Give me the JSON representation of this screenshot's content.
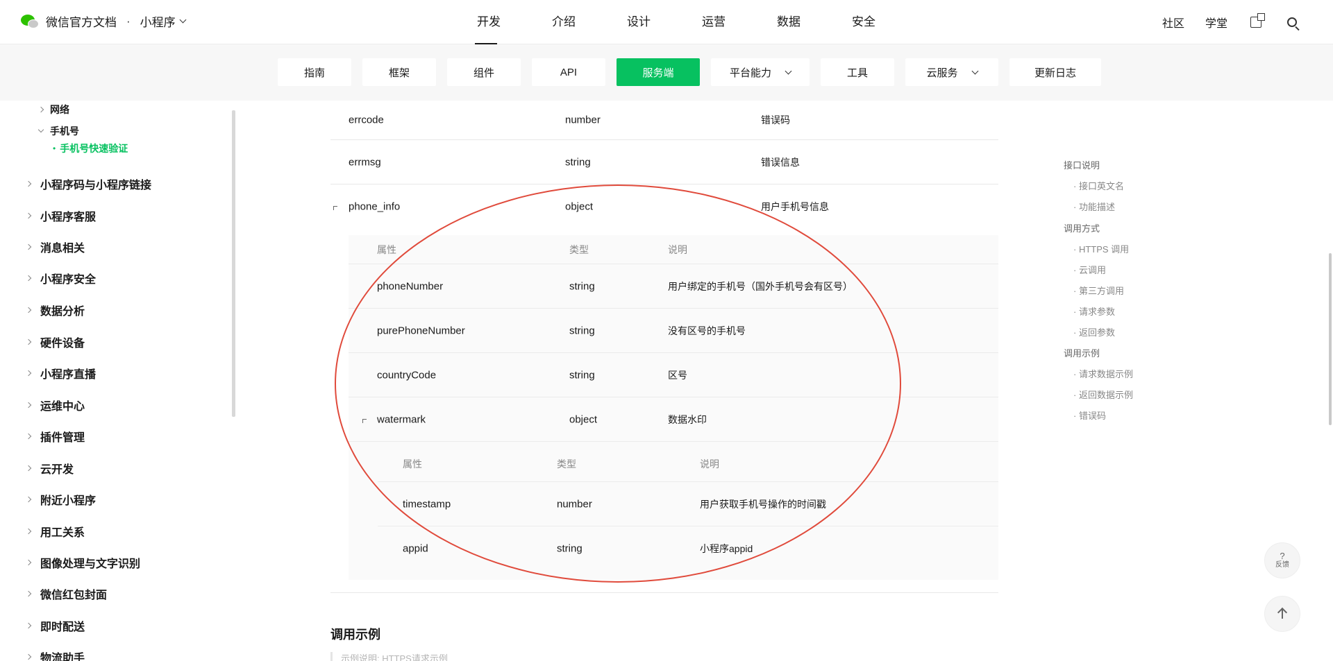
{
  "header": {
    "brand": "微信官方文档",
    "separator": "·",
    "product": "小程序",
    "nav": [
      "开发",
      "介绍",
      "设计",
      "运营",
      "数据",
      "安全"
    ],
    "active_nav": "开发",
    "right_links": [
      "社区",
      "学堂"
    ]
  },
  "subtabs": [
    {
      "label": "指南"
    },
    {
      "label": "框架"
    },
    {
      "label": "组件"
    },
    {
      "label": "API"
    },
    {
      "label": "服务端"
    },
    {
      "label": "平台能力"
    },
    {
      "label": "工具"
    },
    {
      "label": "云服务"
    },
    {
      "label": "更新日志"
    }
  ],
  "active_subtab": "服务端",
  "accent_color": "#07c160",
  "annotation_color": "#e04a3b",
  "sidebar": {
    "sub_items": [
      {
        "label": "网络"
      },
      {
        "label": "手机号"
      }
    ],
    "active_leaf": "手机号快速验证",
    "items": [
      {
        "label": "小程序码与小程序链接"
      },
      {
        "label": "小程序客服"
      },
      {
        "label": "消息相关"
      },
      {
        "label": "小程序安全"
      },
      {
        "label": "数据分析"
      },
      {
        "label": "硬件设备"
      },
      {
        "label": "小程序直播"
      },
      {
        "label": "运维中心"
      },
      {
        "label": "插件管理"
      },
      {
        "label": "云开发"
      },
      {
        "label": "附近小程序"
      },
      {
        "label": "用工关系"
      },
      {
        "label": "图像处理与文字识别"
      },
      {
        "label": "微信红包封面"
      },
      {
        "label": "即时配送"
      },
      {
        "label": "物流助手"
      }
    ]
  },
  "table": {
    "rows": [
      {
        "name": "errcode",
        "type": "number",
        "desc": "错误码"
      },
      {
        "name": "errmsg",
        "type": "string",
        "desc": "错误信息"
      },
      {
        "name": "phone_info",
        "type": "object",
        "desc": "用户手机号信息"
      }
    ],
    "nested_header": {
      "attr": "属性",
      "type": "类型",
      "desc": "说明"
    },
    "nested_rows": [
      {
        "name": "phoneNumber",
        "type": "string",
        "desc": "用户绑定的手机号（国外手机号会有区号）"
      },
      {
        "name": "purePhoneNumber",
        "type": "string",
        "desc": "没有区号的手机号"
      },
      {
        "name": "countryCode",
        "type": "string",
        "desc": "区号"
      },
      {
        "name": "watermark",
        "type": "object",
        "desc": "数据水印"
      }
    ],
    "deep_rows": [
      {
        "name": "timestamp",
        "type": "number",
        "desc": "用户获取手机号操作的时间戳"
      },
      {
        "name": "appid",
        "type": "string",
        "desc": "小程序appid"
      }
    ]
  },
  "section_heading": "调用示例",
  "example_hint": "示例说明: HTTPS请求示例",
  "toc": [
    {
      "label": "接口说明",
      "level": 1
    },
    {
      "label": "接口英文名",
      "level": 2
    },
    {
      "label": "功能描述",
      "level": 2
    },
    {
      "label": "调用方式",
      "level": 1
    },
    {
      "label": "HTTPS 调用",
      "level": 2
    },
    {
      "label": "云调用",
      "level": 2
    },
    {
      "label": "第三方调用",
      "level": 2
    },
    {
      "label": "请求参数",
      "level": 2
    },
    {
      "label": "返回参数",
      "level": 2
    },
    {
      "label": "调用示例",
      "level": 1
    },
    {
      "label": "请求数据示例",
      "level": 2
    },
    {
      "label": "返回数据示例",
      "level": 2
    },
    {
      "label": "错误码",
      "level": 2
    }
  ],
  "feedback": {
    "icon_text": "?",
    "label": "反馈"
  }
}
